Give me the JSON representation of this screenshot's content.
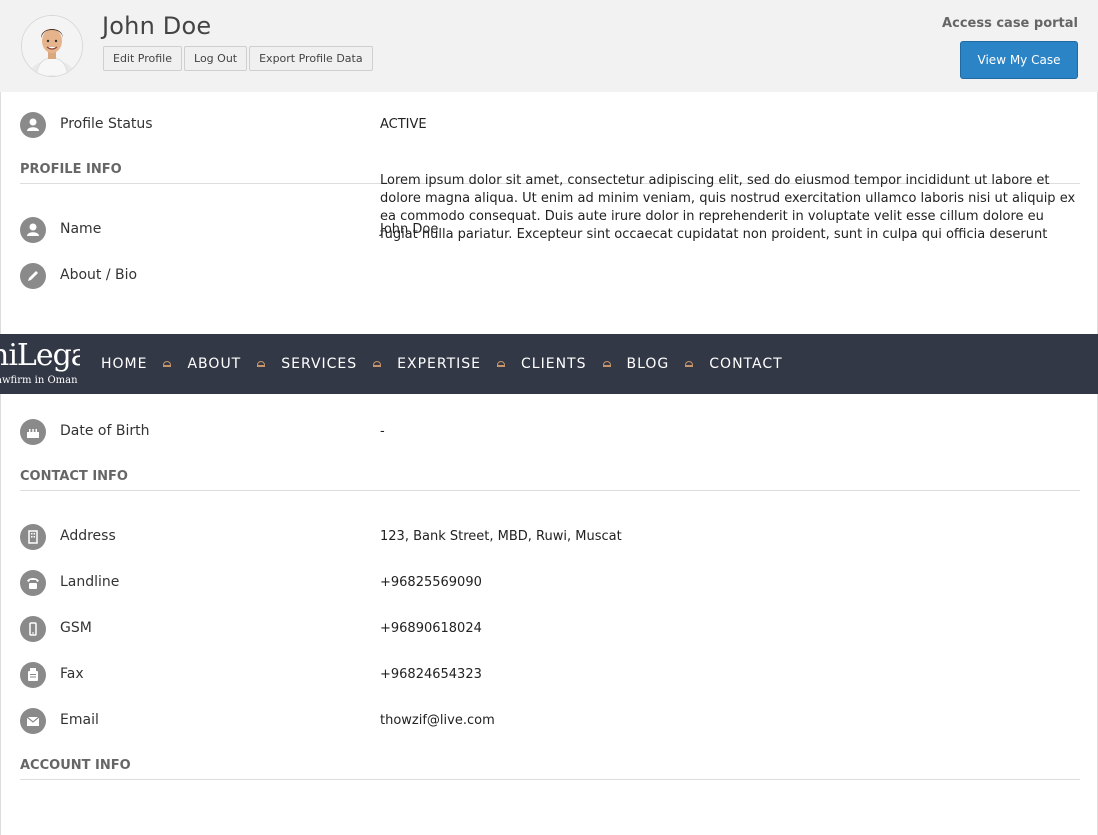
{
  "profile": {
    "name": "John Doe",
    "buttons": {
      "edit": "Edit Profile",
      "logout": "Log Out",
      "export": "Export Profile Data"
    },
    "portal_label": "Access case portal",
    "view_case": "View My Case"
  },
  "status": {
    "label": "Profile Status",
    "value": "ACTIVE"
  },
  "sections": {
    "profile_info": "PROFILE INFO",
    "contact_info": "CONTACT INFO",
    "account_info": "ACCOUNT INFO"
  },
  "profile_info": {
    "name_label": "Name",
    "name_value": "John Doe",
    "bio_label": "About / Bio",
    "bio_value": "Lorem ipsum dolor sit amet, consectetur adipiscing elit, sed do eiusmod tempor incididunt ut labore et dolore magna aliqua. Ut enim ad minim veniam, quis nostrud exercitation ullamco laboris nisi ut aliquip ex ea commodo consequat. Duis aute irure dolor in reprehenderit in voluptate velit esse cillum dolore eu fugiat nulla pariatur. Excepteur sint occaecat cupidatat non proident, sunt in culpa qui officia deserunt",
    "dob_label": "Date of Birth",
    "dob_value": "-"
  },
  "contact_info": {
    "address_label": "Address",
    "address_value": "123, Bank Street, MBD, Ruwi, Muscat",
    "landline_label": "Landline",
    "landline_value": "+96825569090",
    "gsm_label": "GSM",
    "gsm_value": "+96890618024",
    "fax_label": "Fax",
    "fax_value": "+96824654323",
    "email_label": "Email",
    "email_value": "thowzif@live.com"
  },
  "navbar": {
    "logo_big": "niLegal",
    "logo_small": "awfirm in Oman",
    "items": [
      "HOME",
      "ABOUT",
      "SERVICES",
      "EXPERTISE",
      "CLIENTS",
      "BLOG",
      "CONTACT"
    ]
  },
  "colors": {
    "nav_bg": "#333847",
    "accent_blue": "#2a84c6",
    "separator": "#c7946a",
    "icon_gray": "#8a8a8a"
  },
  "icons": [
    "user-icon",
    "pencil-icon",
    "cake-icon",
    "building-icon",
    "phone-icon",
    "mobile-icon",
    "fax-icon",
    "envelope-icon"
  ]
}
